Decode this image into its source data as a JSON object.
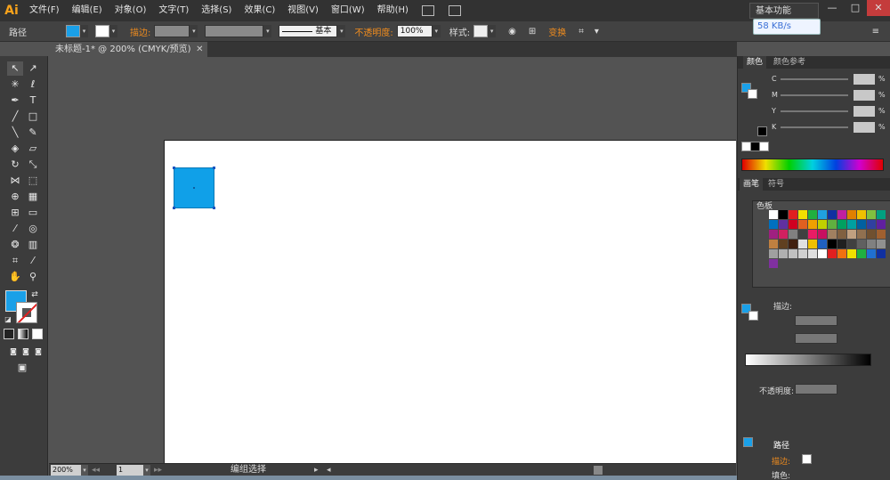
{
  "app": {
    "logo": "Ai"
  },
  "menubar": {
    "items": [
      "文件(F)",
      "编辑(E)",
      "对象(O)",
      "文字(T)",
      "选择(S)",
      "效果(C)",
      "视图(V)",
      "窗口(W)",
      "帮助(H)"
    ],
    "workspace": "基本功能",
    "minimize": "—",
    "maximize": "□",
    "close": "✕"
  },
  "network_badge": "58 KB/s",
  "controlbar": {
    "path_label": "路径",
    "stroke_label": "描边:",
    "brush_style": "基本",
    "opacity_label": "不透明度:",
    "opacity_value": "100%",
    "style_label": "样式:",
    "transform_label": "变换"
  },
  "document": {
    "tab_title": "未标题-1* @ 200% (CMYK/预览)",
    "tab_close": "✕"
  },
  "colors": {
    "fill": "#1aa0e8",
    "stroke": "none",
    "object": "#10a0e8"
  },
  "statusbar": {
    "zoom": "200%",
    "page": "1",
    "status_text": "编组选择"
  },
  "panels": {
    "color_tab": "颜色",
    "color_guide_tab": "颜色参考",
    "cmyk": [
      {
        "letter": "C",
        "unit": "%"
      },
      {
        "letter": "M",
        "unit": "%"
      },
      {
        "letter": "Y",
        "unit": "%"
      },
      {
        "letter": "K",
        "unit": "%"
      }
    ],
    "brush_tab": "画笔",
    "symbol_tab": "符号",
    "swatches_tab": "色板",
    "stroke_label": "描边:",
    "opacity_label": "不透明度:",
    "appearance_title": "路径",
    "appearance_stroke": "描边:",
    "appearance_fill": "填色:"
  },
  "swatch_colors": [
    "#ffffff",
    "#000000",
    "#e02020",
    "#f0e000",
    "#20b040",
    "#20a0e0",
    "#1030a0",
    "#c020a0",
    "#e08000",
    "#f0c000",
    "#80c040",
    "#00a080",
    "#0070c0",
    "#6030a0",
    "#d00020",
    "#e06020",
    "#f0a000",
    "#c0d000",
    "#60b040",
    "#00a060",
    "#00a0a0",
    "#0060a0",
    "#3040a0",
    "#6020a0",
    "#a02080",
    "#d02060",
    "#808080",
    "#404040",
    "#e81c64",
    "#c81060",
    "#a08060",
    "#806040",
    "#c0a080",
    "#907050",
    "#705030",
    "#a06030",
    "#c08040",
    "#604020",
    "#402010",
    "#e0e0e0",
    "#f0c000",
    "#2060c0",
    "#000000",
    "#202020",
    "#404040",
    "#606060",
    "#808080",
    "#909090",
    "#a0a0a0",
    "#b0b0b0",
    "#c0c0c0",
    "#d0d0d0",
    "#e0e0e0",
    "#ffffff",
    "#e02020",
    "#f07010",
    "#f0e000",
    "#20b040",
    "#2070d0",
    "#1030a0",
    "#8030a0"
  ]
}
